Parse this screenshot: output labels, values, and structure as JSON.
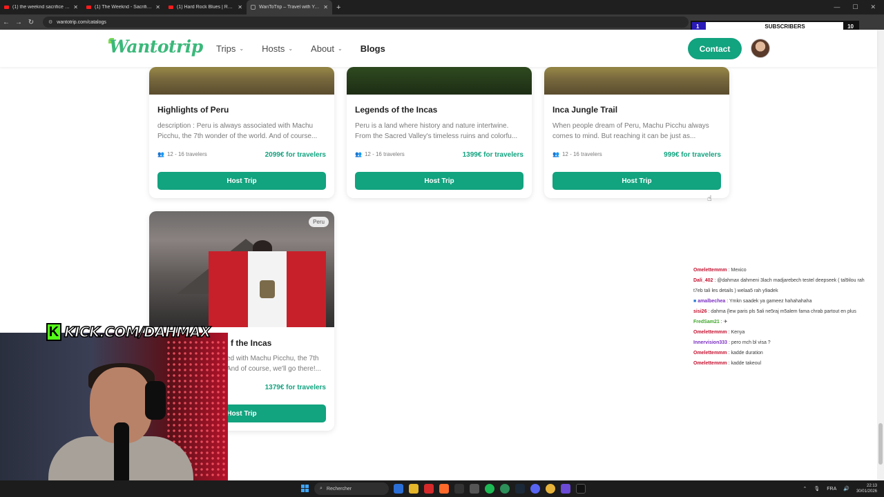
{
  "browser": {
    "tabs": [
      {
        "title": "(1) the weeknd sacrifice - YouTu",
        "icon": "youtube-icon"
      },
      {
        "title": "(1) The Weeknd - Sacrifice - Yo",
        "icon": "youtube-icon"
      },
      {
        "title": "(1) Hard Rock Blues | Raw R",
        "icon": "youtube-icon"
      },
      {
        "title": "WanToTrip – Travel with Your F",
        "icon": "page-icon",
        "active": true
      }
    ],
    "url": "wantotrip.com/catalogs"
  },
  "overlay": {
    "subs_count": "1",
    "subs_label": "SUBSCRIBERS",
    "subs_goal": "10",
    "kick_url": "KICK.COM/DAHMAX"
  },
  "header": {
    "logo": "Wantotrip",
    "nav": [
      {
        "label": "Trips",
        "dropdown": true
      },
      {
        "label": "Hosts",
        "dropdown": true
      },
      {
        "label": "About",
        "dropdown": true
      },
      {
        "label": "Blogs",
        "dropdown": false
      }
    ],
    "contact_label": "Contact"
  },
  "cards": [
    {
      "title": "Highlights of Peru",
      "desc": "description : Peru is always associated with Machu Picchu, the 7th wonder of the world. And of course...",
      "travelers": "12 - 16 travelers",
      "price": "2099€ for travelers",
      "button": "Host Trip"
    },
    {
      "title": "Legends of the Incas",
      "desc": "Peru is a land where history and nature intertwine. From the Sacred Valley's timeless ruins and colorfu...",
      "travelers": "12 - 16 travelers",
      "price": "1399€ for travelers",
      "button": "Host Trip"
    },
    {
      "title": "Inca Jungle Trail",
      "desc": "When people dream of Peru, Machu Picchu always comes to mind. But reaching it can be just as...",
      "travelers": "12 - 16 travelers",
      "price": "999€ for travelers",
      "button": "Host Trip"
    },
    {
      "badge": "Peru",
      "title": "f the Incas",
      "desc": "ed with Machu Picchu, the 7th And of course, we'll go there!...",
      "travelers": "",
      "price": "1379€ for travelers",
      "button": "Host Trip"
    }
  ],
  "chat": [
    {
      "user": "Omelettemmm",
      "msg": ": Mexico",
      "color": "#c4102e"
    },
    {
      "user": "Dali_402",
      "msg": ": @dahmax dahmeni 3lach madjarebech testel deepseek ( tal9ilou rah t7eb tali les details ) welaa5 rah y9adek",
      "color": "#c4102e"
    },
    {
      "user": "amalbechea",
      "msg": ": Ymkn saadek ya gameez hahahahaha",
      "color": "#7b2fc2"
    },
    {
      "user": "sisi26",
      "msg": ": dahma {lew paris pls 5ali ne5raj m5alem fama chrab partout en plus",
      "color": "#c4102e"
    },
    {
      "user": "FredSam21",
      "msg": ": ✈",
      "color": "#3fa62a"
    },
    {
      "user": "Omelettemmm",
      "msg": ": Kenya",
      "color": "#c4102e"
    },
    {
      "user": "Innervision333",
      "msg": ": pero mch bl visa ?",
      "color": "#7b2fc2"
    },
    {
      "user": "Omelettemmm",
      "msg": ": kadde duration",
      "color": "#c4102e"
    },
    {
      "user": "Omelettemmm",
      "msg": ": kadde takeoul",
      "color": "#c4102e"
    }
  ],
  "taskbar": {
    "search_placeholder": "Rechercher",
    "lang": "FRA",
    "time": "22:13",
    "date": "30/01/2026"
  }
}
